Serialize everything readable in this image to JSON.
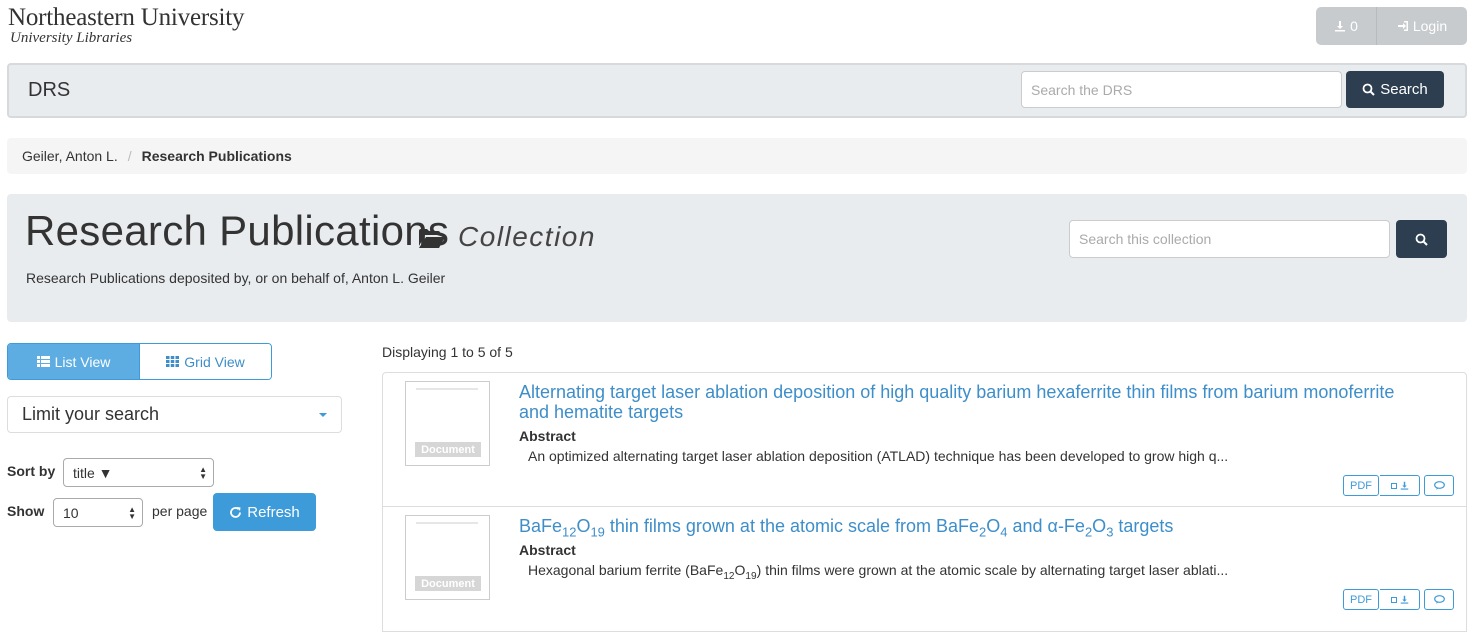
{
  "header": {
    "university": "Northeastern University",
    "libraries": "University Libraries",
    "download_count": "0",
    "login_label": "Login"
  },
  "navbar": {
    "brand": "DRS",
    "search_placeholder": "Search the DRS",
    "search_button": "Search"
  },
  "breadcrumb": {
    "items": [
      "Geiler, Anton L.",
      "Research Publications"
    ]
  },
  "collection": {
    "title": "Research Publications",
    "type": "Collection",
    "description": "Research Publications deposited by, or on behalf of, Anton L. Geiler",
    "search_placeholder": "Search this collection"
  },
  "sidebar": {
    "list_view": "List View",
    "grid_view": "Grid View",
    "limit_search": "Limit your search",
    "sort_by_label": "Sort by",
    "sort_value": "title ▼",
    "show_label": "Show",
    "show_value": "10",
    "per_page": "per page",
    "refresh": "Refresh"
  },
  "results": {
    "displaying": "Displaying 1 to 5 of 5",
    "abstract_label": "Abstract",
    "thumb_label": "Document",
    "pdf_label": "PDF",
    "items": [
      {
        "title_line1": "Alternating target laser ablation deposition of high quality barium hexaferrite thin films from barium monoferrite",
        "title_line2": "and hematite targets",
        "abstract": "An optimized alternating target laser ablation deposition (ATLAD) technique has been developed to grow high q..."
      },
      {
        "title": "BaFe12O19 thin films grown at the atomic scale from BaFe2O4 and α-Fe2O3 targets",
        "abstract": "Hexagonal barium ferrite (BaFe12O19) thin films were grown at the atomic scale by alternating target laser ablati..."
      }
    ]
  },
  "colors": {
    "primary_dark": "#2c3e50",
    "link_blue": "#3d8ec9",
    "button_blue": "#3d9bd9",
    "panel_gray": "#e9ecef"
  }
}
